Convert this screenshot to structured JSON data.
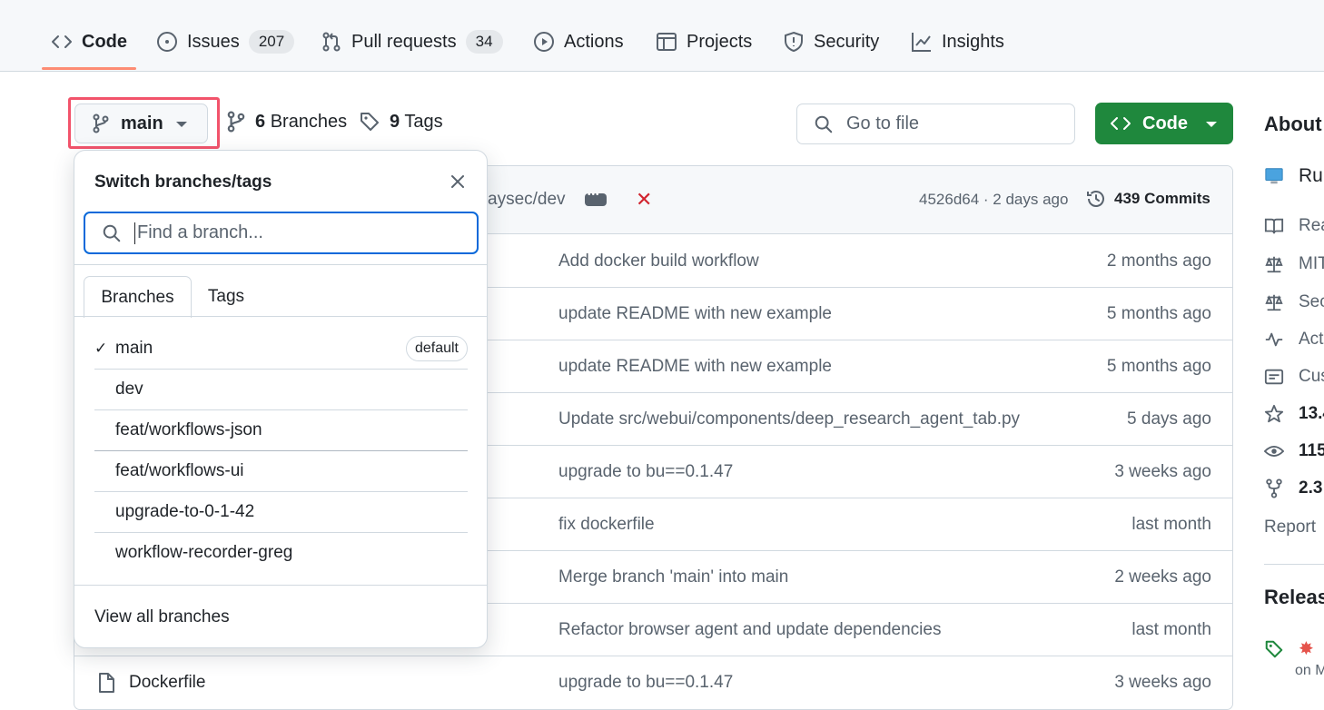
{
  "nav": {
    "code": "Code",
    "issues": "Issues",
    "issues_count": "207",
    "pulls": "Pull requests",
    "pulls_count": "34",
    "actions": "Actions",
    "projects": "Projects",
    "security": "Security",
    "insights": "Insights"
  },
  "branch_bar": {
    "current_branch": "main",
    "branches_count": "6",
    "branches_label": "Branches",
    "tags_count": "9",
    "tags_label": "Tags",
    "goto_placeholder": "Go to file",
    "code_button": "Code"
  },
  "commit_header": {
    "partial_author": "aysec/dev",
    "hash_time": "4526d64 · 2 days ago",
    "commits": "439 Commits"
  },
  "files": [
    {
      "message": "Add docker build workflow",
      "age": "2 months ago"
    },
    {
      "message": "update README with new example",
      "age": "5 months ago"
    },
    {
      "message": "update README with new example",
      "age": "5 months ago"
    },
    {
      "message": "Update src/webui/components/deep_research_agent_tab.py",
      "age": "5 days ago"
    },
    {
      "message": "upgrade to bu==0.1.47",
      "age": "3 weeks ago"
    },
    {
      "message": "fix dockerfile",
      "age": "last month"
    },
    {
      "message": "Merge branch 'main' into main",
      "age": "2 weeks ago"
    },
    {
      "message": "Refactor browser agent and update dependencies",
      "age": "last month"
    },
    {
      "name": "Dockerfile",
      "message": "upgrade to bu==0.1.47",
      "age": "3 weeks ago"
    }
  ],
  "dropdown": {
    "title": "Switch branches/tags",
    "search_placeholder": "Find a branch...",
    "tab_branches": "Branches",
    "tab_tags": "Tags",
    "check": "✓",
    "default_badge": "default",
    "branches": [
      "main",
      "dev",
      "feat/workflows-json",
      "feat/workflows-ui",
      "upgrade-to-0-1-42",
      "workflow-recorder-greg"
    ],
    "view_all": "View all branches"
  },
  "sidebar": {
    "about": "About",
    "lines": [
      "Ru",
      "Rea",
      "MIT",
      "Sec",
      "Act",
      "Cus",
      "13.4",
      "115",
      "2.3"
    ],
    "report": "Report",
    "releases": "Releas",
    "release_date": "on M"
  },
  "colors": {
    "accent": "#0969da",
    "primary_button": "#1f883d",
    "nav_underline": "#fd8c73",
    "highlight": "#f2536b",
    "danger": "#d1242f"
  }
}
